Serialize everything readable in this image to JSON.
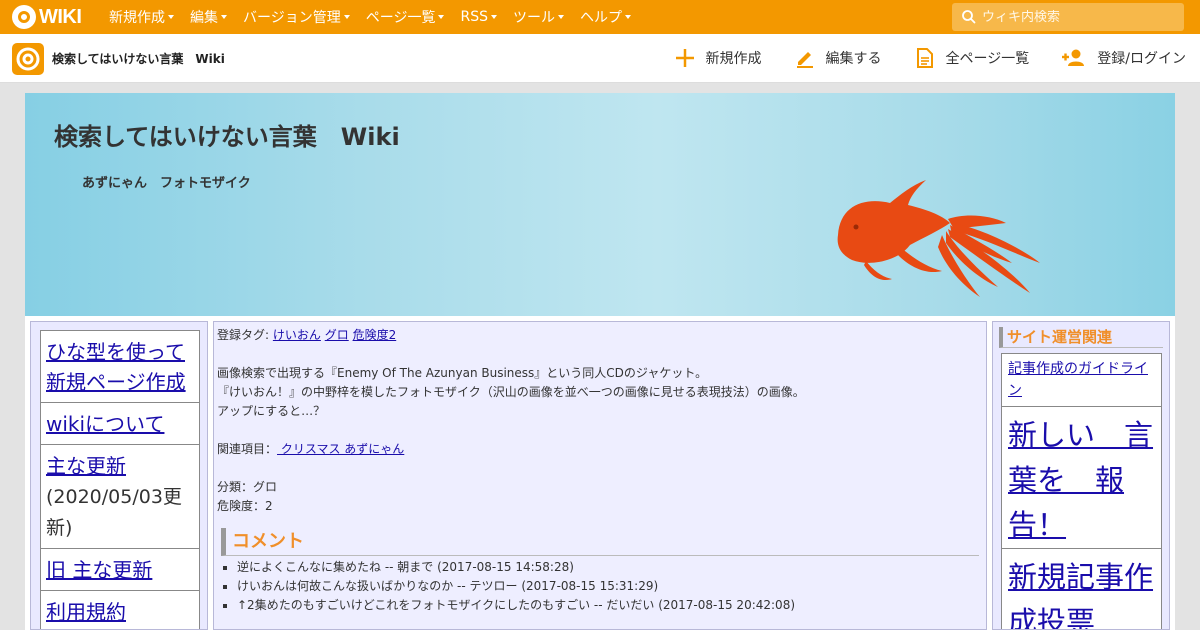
{
  "topbar": {
    "logo_text": "WIKI",
    "nav": [
      "新規作成",
      "編集",
      "バージョン管理",
      "ページ一覧",
      "RSS",
      "ツール",
      "ヘルプ"
    ],
    "search_placeholder": "ウィキ内検索"
  },
  "subbar": {
    "site_title": "検索してはいけない言葉　Wiki",
    "actions": [
      {
        "label": "新規作成",
        "icon": "plus-icon"
      },
      {
        "label": "編集する",
        "icon": "pencil-icon"
      },
      {
        "label": "全ページ一覧",
        "icon": "document-icon"
      },
      {
        "label": "登録/ログイン",
        "icon": "add-user-icon"
      }
    ]
  },
  "banner": {
    "title": "検索してはいけない言葉　Wiki",
    "subtitle": "あずにゃん　フォトモザイク"
  },
  "leftnav": {
    "items": [
      {
        "label": "ひな型を使って新規ページ作成"
      },
      {
        "label": "wikiについて"
      },
      {
        "label": "主な更新",
        "note": "(2020/05/03更新)"
      },
      {
        "label": "旧 主な更新"
      },
      {
        "label": "利用規約"
      }
    ]
  },
  "main": {
    "tags_label": "登録タグ:",
    "tags": [
      "けいおん",
      "グロ",
      "危険度2"
    ],
    "desc_1": "画像検索で出現する『Enemy Of The Azunyan Business』という同人CDのジャケット。",
    "desc_2": "『けいおん！』の中野梓を模したフォトモザイク（沢山の画像を並べ一つの画像に見せる表現技法）の画像。",
    "desc_3": "アップにすると…？",
    "related_label": "関連項目：",
    "related_link": " クリスマス あずにゃん",
    "category": "分類：グロ",
    "danger": "危険度：2",
    "comment_heading": "コメント",
    "comments": [
      "逆によくこんなに集めたね -- 朝まで (2017-08-15 14:58:28)",
      "けいおんは何故こんな扱いばかりなのか -- テツロー (2017-08-15 15:31:29)",
      "↑2集めたのもすごいけどこれをフォトモザイクにしたのもすごい -- だいだい (2017-08-15 20:42:08)"
    ]
  },
  "rightcol": {
    "heading": "サイト運営関連",
    "items": [
      {
        "label": "記事作成のガイドライン",
        "size": "small"
      },
      {
        "label": "新しい　言葉を　報告！",
        "size": "big"
      },
      {
        "label": "新規記事作成投票",
        "size": "big"
      }
    ]
  },
  "colors": {
    "accent": "#f39800",
    "heading_orange": "#f08f2a",
    "link": "#1a0dab",
    "goldfish": "#e84a13"
  }
}
